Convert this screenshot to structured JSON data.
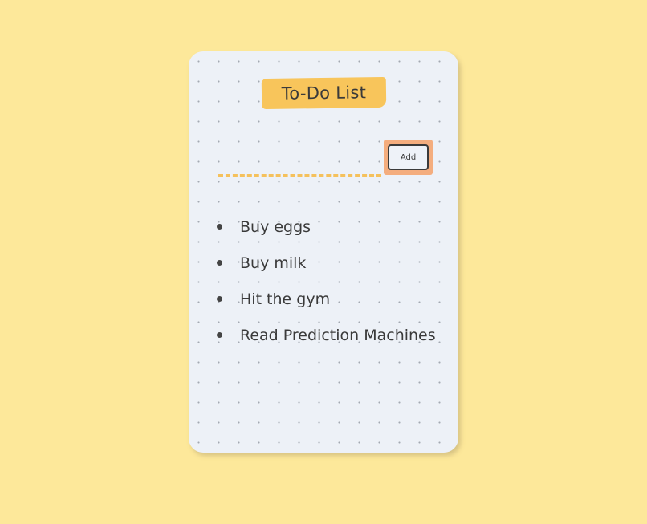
{
  "card": {
    "title": "To-Do List"
  },
  "input": {
    "value": "",
    "placeholder": ""
  },
  "add_button": {
    "label": "Add"
  },
  "todos": [
    {
      "text": "Buy eggs"
    },
    {
      "text": "Buy milk"
    },
    {
      "text": "Hit the gym"
    },
    {
      "text": "Read Prediction Machines"
    }
  ],
  "colors": {
    "background": "#fde89a",
    "card": "#edf1f7",
    "title_tag": "#f8c55b",
    "input_underline": "#f5c15c",
    "button_outline": "#f4ad7e",
    "text": "#3a3a3a"
  }
}
